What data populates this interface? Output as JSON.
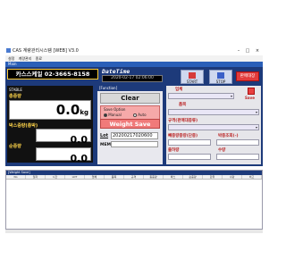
{
  "window": {
    "title": "CAS 계량관리시스템 [WEB] V3.0",
    "minimize": "–",
    "maximize": "□",
    "close": "×"
  },
  "menu": [
    "설정",
    "계량관리",
    "종료"
  ],
  "subbar": "Main",
  "company": {
    "name": "카스스케일  02-3665-8158"
  },
  "datetime": {
    "label": "DateTime",
    "value": "2020-02-17  02:06:00"
  },
  "toolbar": {
    "start": "START",
    "stop": "STOP",
    "report": "판매대장"
  },
  "weights": {
    "stable": "STABLE",
    "total_label": "총중량",
    "total_value": "0.0",
    "total_unit": "kg",
    "tare_label": "박스중량(총박)",
    "tare_value": "0.0",
    "net_label": "순중량",
    "net_value": "0.0"
  },
  "function": {
    "header": "[Function]",
    "clear": "Clear",
    "save_option": "Save Option",
    "manual": "Manual",
    "auto": "Auto",
    "weight_save": "Weight Save",
    "lot_label": "Lot",
    "lot_value": "20200217020600",
    "memo_label": "MEMO"
  },
  "right_panel": {
    "client_label": "업체",
    "save_label": "Save",
    "item_label": "품목",
    "spec_label": "규격(판매대종류)",
    "box_weight_label": "빼중량중량(단중)",
    "count_label": "박중조회(-)",
    "inout_label": "출하량",
    "qty_label": "수량"
  },
  "grid": {
    "header": "[Weight Save]",
    "columns": [
      "No",
      "일자",
      "시간",
      "LOT",
      "업체",
      "품목",
      "규격",
      "총중량",
      "박스",
      "순중량",
      "단위",
      "수량",
      "비고"
    ]
  }
}
